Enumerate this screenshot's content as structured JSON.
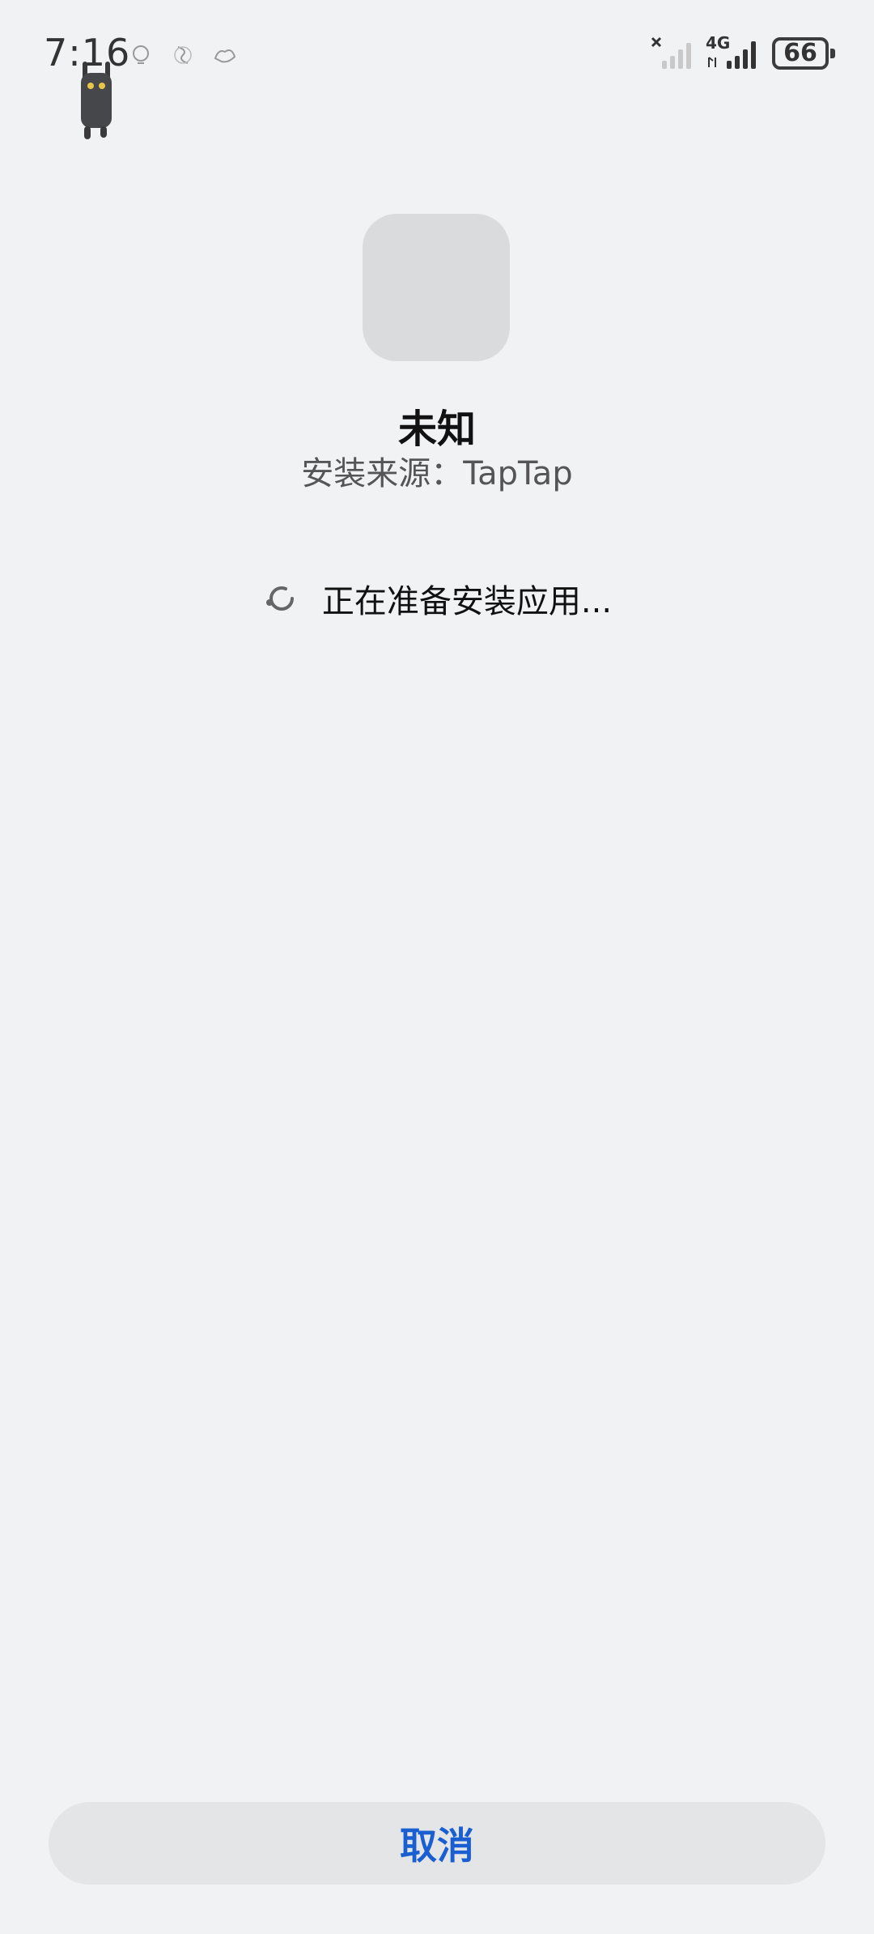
{
  "status_bar": {
    "time": "7:16",
    "network": "4G",
    "battery_level": "66",
    "icons": [
      "cat-sticker-icon",
      "notification-icon-1",
      "notification-icon-2",
      "notification-icon-3",
      "no-signal-sim1-icon",
      "signal-4g-icon",
      "battery-icon"
    ]
  },
  "app": {
    "name": "未知",
    "install_source": "安装来源：TapTap"
  },
  "status": {
    "icon": "loading-spinner-icon",
    "text": "正在准备安装应用..."
  },
  "actions": {
    "cancel_label": "取消"
  },
  "colors": {
    "background": "#f1f2f4",
    "accent": "#1a5fd1",
    "button_bg": "#e4e5e7",
    "icon_placeholder": "#dadbdd"
  }
}
